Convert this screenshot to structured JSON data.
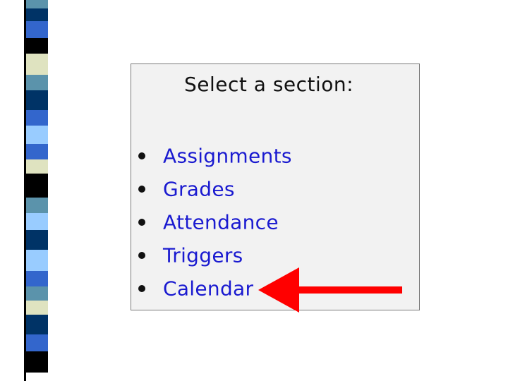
{
  "panel": {
    "title": "Select a section:",
    "sections": [
      {
        "label": "Assignments"
      },
      {
        "label": "Grades"
      },
      {
        "label": "Attendance"
      },
      {
        "label": "Triggers"
      },
      {
        "label": "Calendar"
      }
    ],
    "link_color": "#1a1ad0"
  },
  "annotation": {
    "arrow_color": "#ff0000",
    "points_to": "Calendar"
  },
  "decoration": {
    "stripe_colors": [
      "#5b93ab",
      "#003366",
      "#3366cc",
      "#dfe3c0",
      "#99ccff",
      "#000000"
    ]
  }
}
